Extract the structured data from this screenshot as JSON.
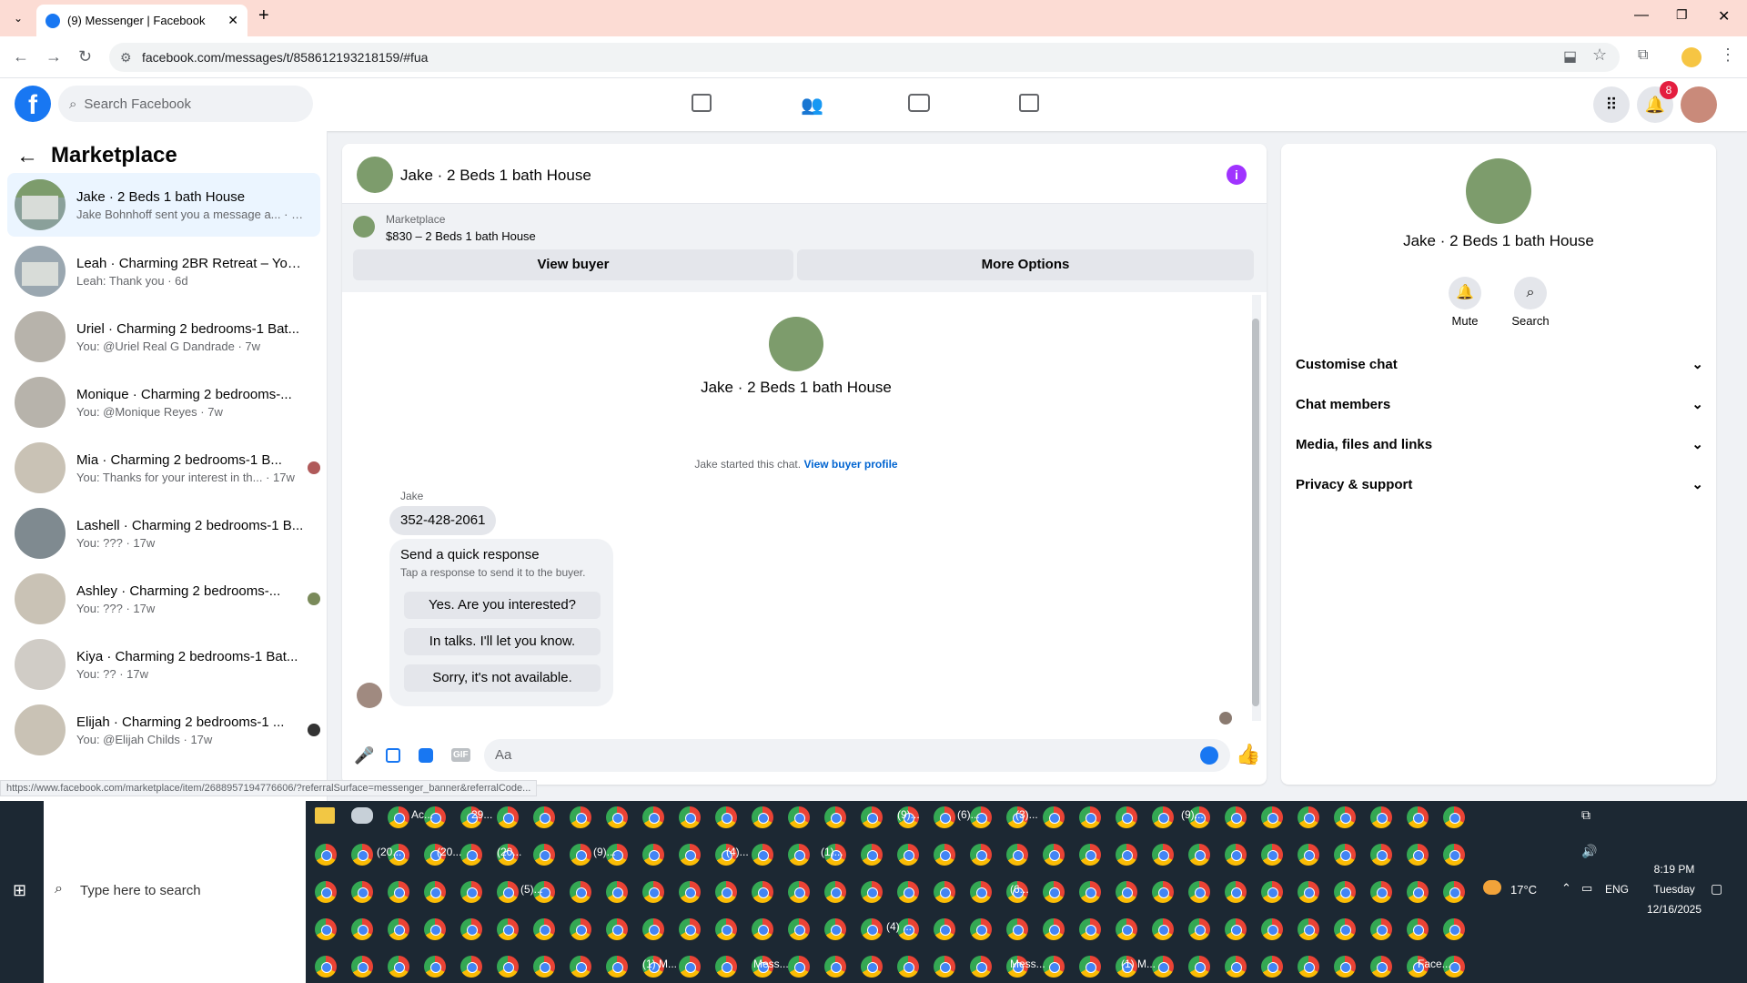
{
  "browser": {
    "tab_title": "(9) Messenger | Facebook",
    "url": "facebook.com/messages/t/858612193218159/#fua",
    "status_url": "https://www.facebook.com/marketplace/item/2688957194776606/?referralSurface=messenger_banner&referralCode..."
  },
  "header": {
    "search_placeholder": "Search Facebook",
    "notification_count": "8"
  },
  "sidebar": {
    "title": "Marketplace",
    "conversations": [
      {
        "title": "Jake · 2 Beds 1 bath House",
        "preview": "Jake Bohnhoff sent you a message a...",
        "time": "· 3m"
      },
      {
        "title": "Leah · Charming 2BR Retreat – You...",
        "preview": "Leah: Thank you · 6d",
        "time": ""
      },
      {
        "title": "Uriel · Charming 2 bedrooms-1 Bat...",
        "preview": "You: @Uriel Real G Dandrade · 7w",
        "time": ""
      },
      {
        "title": "Monique · Charming 2 bedrooms-...",
        "preview": "You: @Monique Reyes · 7w",
        "time": ""
      },
      {
        "title": "Mia · Charming 2 bedrooms-1 B...",
        "preview": "You: Thanks for your interest in th... · 17w",
        "time": ""
      },
      {
        "title": "Lashell · Charming 2 bedrooms-1 B...",
        "preview": "You: ??? · 17w",
        "time": ""
      },
      {
        "title": "Ashley · Charming 2 bedrooms-...",
        "preview": "You: ??? · 17w",
        "time": ""
      },
      {
        "title": "Kiya · Charming 2 bedrooms-1 Bat...",
        "preview": "You: ?? · 17w",
        "time": ""
      },
      {
        "title": "Elijah · Charming 2 bedrooms-1 ...",
        "preview": "You: @Elijah Childs · 17w",
        "time": ""
      }
    ]
  },
  "chat": {
    "title": "Jake · 2 Beds 1 bath House",
    "listing_source": "Marketplace",
    "listing_price": "$830 – 2 Beds 1 bath House",
    "view_buyer": "View buyer",
    "more_options": "More Options",
    "intro_name": "Jake · 2 Beds 1 bath House",
    "started_text": "Jake started this chat.",
    "view_profile": "View buyer profile",
    "sender": "Jake",
    "message": "352-428-2061",
    "quick_title": "Send a quick response",
    "quick_sub": "Tap a response to send it to the buyer.",
    "quick_replies": [
      "Yes. Are you interested?",
      "In talks. I'll let you know.",
      "Sorry, it's not available."
    ],
    "composer_placeholder": "Aa"
  },
  "info": {
    "name": "Jake · 2 Beds 1 bath House",
    "mute": "Mute",
    "search": "Search",
    "sections": [
      "Customise chat",
      "Chat members",
      "Media, files and links",
      "Privacy & support"
    ]
  },
  "taskbar": {
    "search_placeholder": "Type here to search",
    "labels_row1": [
      "Ac...",
      "29...",
      "(9)...",
      "(6)...",
      "(3)...",
      "(9)..."
    ],
    "labels_row2": [
      "(20...",
      "(20...",
      "(20...",
      "(9)...",
      "(4)...",
      "(1)..."
    ],
    "labels_row3": [
      "(5)...",
      "(6..."
    ],
    "labels_row4": [
      "(4) ..."
    ],
    "labels_row5": [
      "(1) M...",
      "Mess...",
      "Mess...",
      "(1) M...",
      "Face..."
    ],
    "weather": "17°C",
    "language": "ENG",
    "time": "8:19 PM",
    "day": "Tuesday",
    "date": "12/16/2025"
  },
  "colors": {
    "brand": "#1877f2",
    "notification": "#e41e3f",
    "info_icon": "#a033ff"
  }
}
